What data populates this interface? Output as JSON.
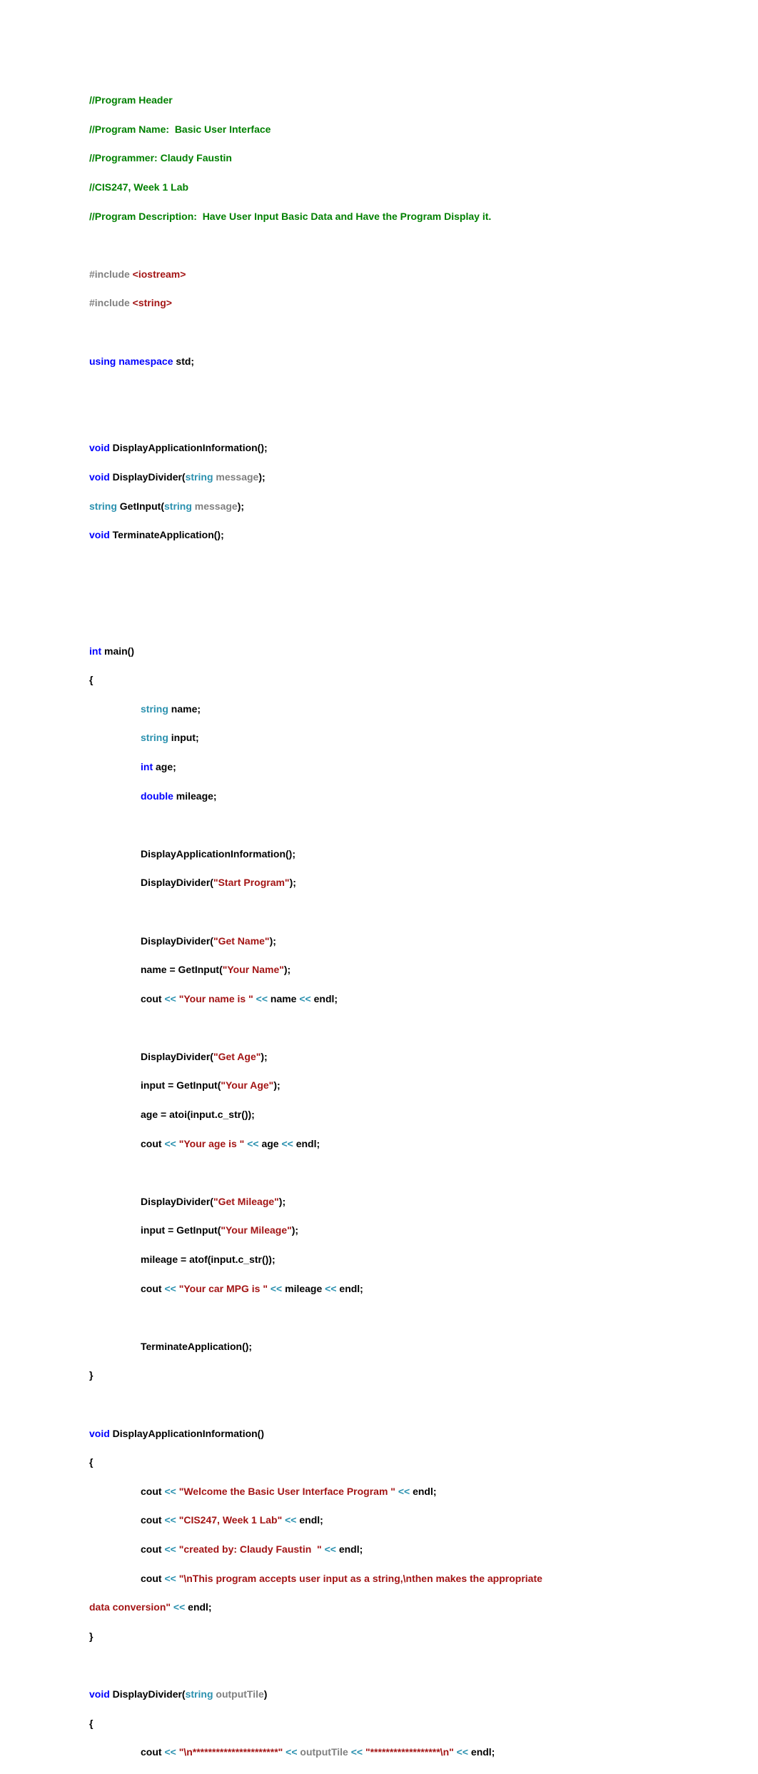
{
  "code": {
    "comments": {
      "header": "//Program Header",
      "progName": "//Program Name:  Basic User Interface",
      "programmer": "//Programmer: Claudy Faustin",
      "course": "//CIS247, Week 1 Lab",
      "desc": "//Program Description:  Have User Input Basic Data and Have the Program Display it."
    },
    "preproc": {
      "include": "#include",
      "iostream": " <iostream>",
      "string": " <string>"
    },
    "kw": {
      "using": "using",
      "namespace": "namespace",
      "void": "void",
      "int": "int",
      "double": "double"
    },
    "types": {
      "string": "string"
    },
    "params": {
      "message1": " message",
      "message2": " message",
      "outputTile": " outputTile"
    },
    "decl": {
      "std": " std;",
      "dai": " DisplayApplicationInformation();",
      "dd_open": " DisplayDivider(",
      "dd_close": ");",
      "gi_open": " GetInput(",
      "gi_close": ");",
      "ta": " TerminateApplication();",
      "main": " main()",
      "brace_open": "{",
      "brace_close": "}",
      "name": " name;",
      "input": " input;",
      "age": " age;",
      "mileage": " mileage;"
    },
    "strings": {
      "startProgram": "\"Start Program\"",
      "getName": "\"Get Name\"",
      "yourName": "\"Your Name\"",
      "yourNameIs": "\"Your name is \"",
      "getAge": "\"Get Age\"",
      "yourAge": "\"Your Age\"",
      "yourAgeIs": "\"Your age is \"",
      "getMileage": "\"Get Mileage\"",
      "yourMileage": "\"Your Mileage\"",
      "yourCarMpg": "\"Your car MPG is \"",
      "welcome": "\"Welcome the Basic User Interface Program \"",
      "cisLab": "\"CIS247, Week 1 Lab\"",
      "createdBy": "\"created by: Claudy Faustin  \"",
      "programAccepts1": "\"\\nThis program accepts user input as a string,\\nthen makes the appropriate ",
      "programAccepts2": "data conversion\"",
      "dividerLeft": "\"\\n**********************\"",
      "dividerRight": "\"******************\\n\""
    },
    "lines": {
      "dai_call": "DisplayApplicationInformation();",
      "dd_call": "DisplayDivider(",
      "close_paren": ");",
      "name_assign": "name = GetInput(",
      "input_assign": "input = GetInput(",
      "cout": "cout ",
      "lt": "<<",
      "name_end": " name ",
      "age_end": " age ",
      "mileage_end": " mileage ",
      "endl": " endl;",
      "age_assign": "age = atoi(input.c_str());",
      "mileage_assign": "mileage = atof(input.c_str());",
      "ta_call": "TerminateApplication();",
      "dai_def": " DisplayApplicationInformation()",
      "dd_def": " DisplayDivider(",
      "close_paren_only": ")",
      "outputTile": " outputTile "
    }
  }
}
